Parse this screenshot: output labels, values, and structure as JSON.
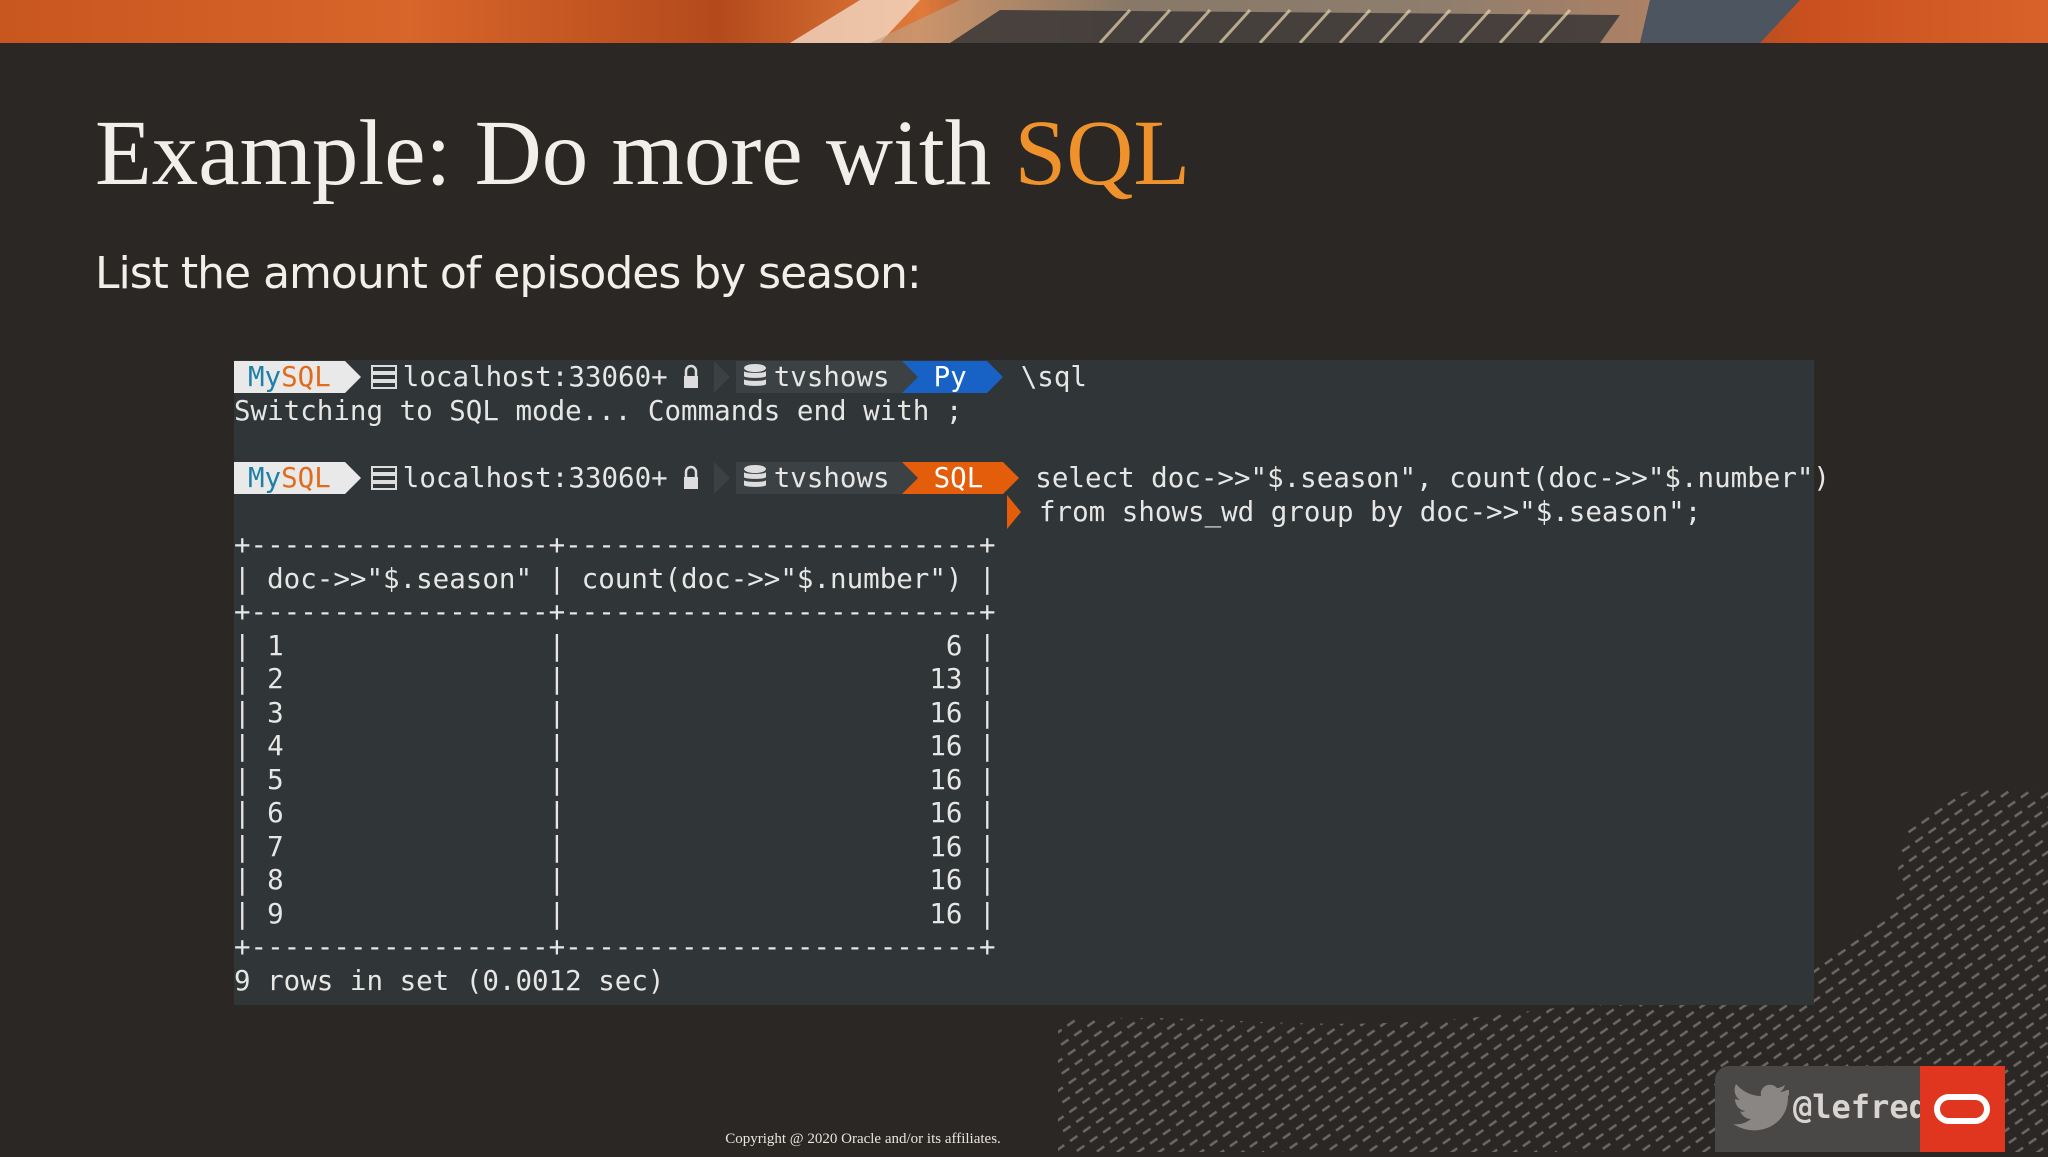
{
  "slide": {
    "title_prefix": "Example: Do more with ",
    "title_accent": "SQL",
    "subtitle": "List the amount of episodes by season:",
    "copyright": "Copyright @ 2020 Oracle and/or its affiliates.",
    "handle": "@lefred",
    "accent_color": "#f0922b"
  },
  "terminal": {
    "prompt": {
      "mysql_my": "My",
      "mysql_sql": "SQL",
      "host": "localhost:33060+",
      "schema": "tvshows"
    },
    "first_mode": "Py",
    "first_cmd": "\\sql",
    "switch_msg": "Switching to SQL mode... Commands end with ;",
    "second_mode": "SQL",
    "query_line1": "select doc->>\"$.season\", count(doc->>\"$.number\")",
    "query_line2": "from shows_wd group by doc->>\"$.season\";",
    "table": {
      "border": "+------------------+-------------------------+",
      "header": "| doc->>\"$.season\" | count(doc->>\"$.number\") |",
      "rows": [
        "| 1                |                       6 |",
        "| 2                |                      13 |",
        "| 3                |                      16 |",
        "| 4                |                      16 |",
        "| 5                |                      16 |",
        "| 6                |                      16 |",
        "| 7                |                      16 |",
        "| 8                |                      16 |",
        "| 9                |                      16 |"
      ]
    },
    "result_msg": "9 rows in set (0.0012 sec)"
  }
}
